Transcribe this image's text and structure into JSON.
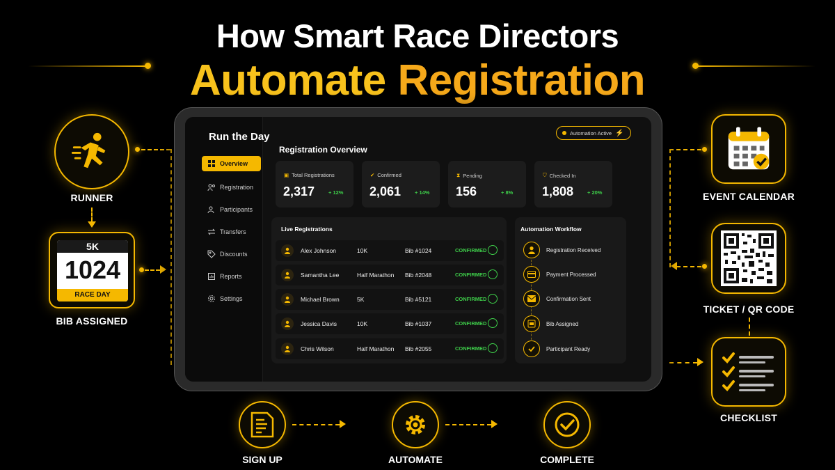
{
  "headline": {
    "line1": "How Smart Race Directors",
    "line2_word1": "Automate",
    "line2_word2": "Registration"
  },
  "left_panel": {
    "runner_label": "RUNNER",
    "bib_label": "BIB ASSIGNED",
    "bib": {
      "distance": "5K",
      "number": "1024",
      "footer": "RACE DAY"
    }
  },
  "right_panel": {
    "calendar_label": "EVENT CALENDAR",
    "ticket_label": "TICKET / QR CODE",
    "checklist_label": "CHECKLIST"
  },
  "app": {
    "brand": "Run the Day",
    "automation_badge": "Automation Active",
    "nav": [
      {
        "label": "Overview",
        "icon": "grid-icon",
        "active": true
      },
      {
        "label": "Registration",
        "icon": "users-icon",
        "active": false
      },
      {
        "label": "Participants",
        "icon": "people-icon",
        "active": false
      },
      {
        "label": "Transfers",
        "icon": "transfer-icon",
        "active": false
      },
      {
        "label": "Discounts",
        "icon": "tag-icon",
        "active": false
      },
      {
        "label": "Reports",
        "icon": "report-icon",
        "active": false
      },
      {
        "label": "Settings",
        "icon": "gear-icon",
        "active": false
      }
    ],
    "overview_title": "Registration Overview",
    "stats": [
      {
        "label": "Total Registrations",
        "value": "2,317",
        "change": "+ 12%"
      },
      {
        "label": "Confirmed",
        "value": "2,061",
        "change": "+ 14%"
      },
      {
        "label": "Pending",
        "value": "156",
        "change": "+ 8%"
      },
      {
        "label": "Checked In",
        "value": "1,808",
        "change": "+ 20%"
      }
    ],
    "live_title": "Live Registrations",
    "registrations": [
      {
        "name": "Alex Johnson",
        "race": "10K",
        "bib": "Bib #1024",
        "status": "CONFIRMED"
      },
      {
        "name": "Samantha Lee",
        "race": "Half Marathon",
        "bib": "Bib #2048",
        "status": "CONFIRMED"
      },
      {
        "name": "Michael Brown",
        "race": "5K",
        "bib": "Bib #5121",
        "status": "CONFIRMED"
      },
      {
        "name": "Jessica Davis",
        "race": "10K",
        "bib": "Bib #1037",
        "status": "CONFIRMED"
      },
      {
        "name": "Chris Wilson",
        "race": "Half Marathon",
        "bib": "Bib #2055",
        "status": "CONFIRMED"
      }
    ],
    "workflow_title": "Automation Workflow",
    "workflow": [
      {
        "label": "Registration Received",
        "icon": "user-icon"
      },
      {
        "label": "Payment Processed",
        "icon": "card-icon"
      },
      {
        "label": "Confirmation Sent",
        "icon": "mail-icon"
      },
      {
        "label": "Bib Assigned",
        "icon": "bib-icon"
      },
      {
        "label": "Participant Ready",
        "icon": "check-icon"
      }
    ]
  },
  "flow": {
    "signup": "SIGN UP",
    "automate": "AUTOMATE",
    "complete": "COMPLETE"
  },
  "colors": {
    "accent": "#f5b800",
    "success": "#3ecf4a",
    "background": "#000000"
  }
}
